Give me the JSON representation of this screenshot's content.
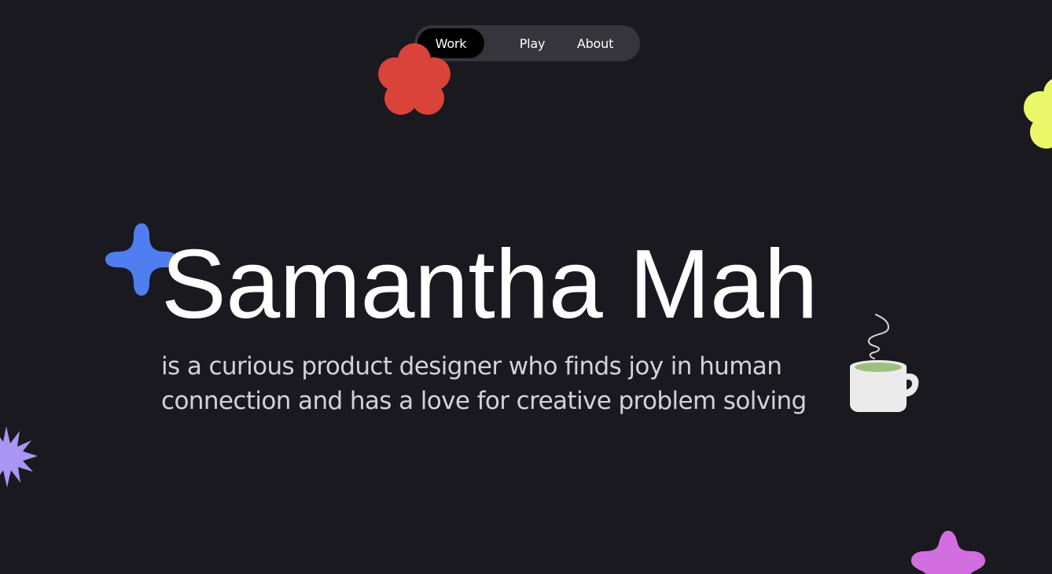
{
  "nav": {
    "items": [
      {
        "label": "Work",
        "active": true
      },
      {
        "label": "Play",
        "active": false
      },
      {
        "label": "About",
        "active": false
      }
    ]
  },
  "hero": {
    "name": "Samantha Mah",
    "tagline_line1": "is a curious product designer who finds joy in human",
    "tagline_line2": "connection and has a love for creative problem solving"
  },
  "decorations": [
    {
      "icon": "red-flower-icon",
      "color": "#d9433a"
    },
    {
      "icon": "yellow-flower-icon",
      "color": "#ebf86a"
    },
    {
      "icon": "blue-sparkle-icon",
      "color": "#4f7ef0"
    },
    {
      "icon": "lavender-starburst-icon",
      "color": "#a995f4"
    },
    {
      "icon": "pink-star-icon",
      "color": "#d26ee0"
    },
    {
      "icon": "coffee-mug-icon",
      "color": "#ebebeb",
      "drink_color": "#9ec07c"
    }
  ],
  "colors": {
    "background": "#1a191f",
    "nav_pill": "#36353b",
    "nav_active": "#000000",
    "heading": "#ffffff",
    "body_text": "#d3d2d8"
  }
}
